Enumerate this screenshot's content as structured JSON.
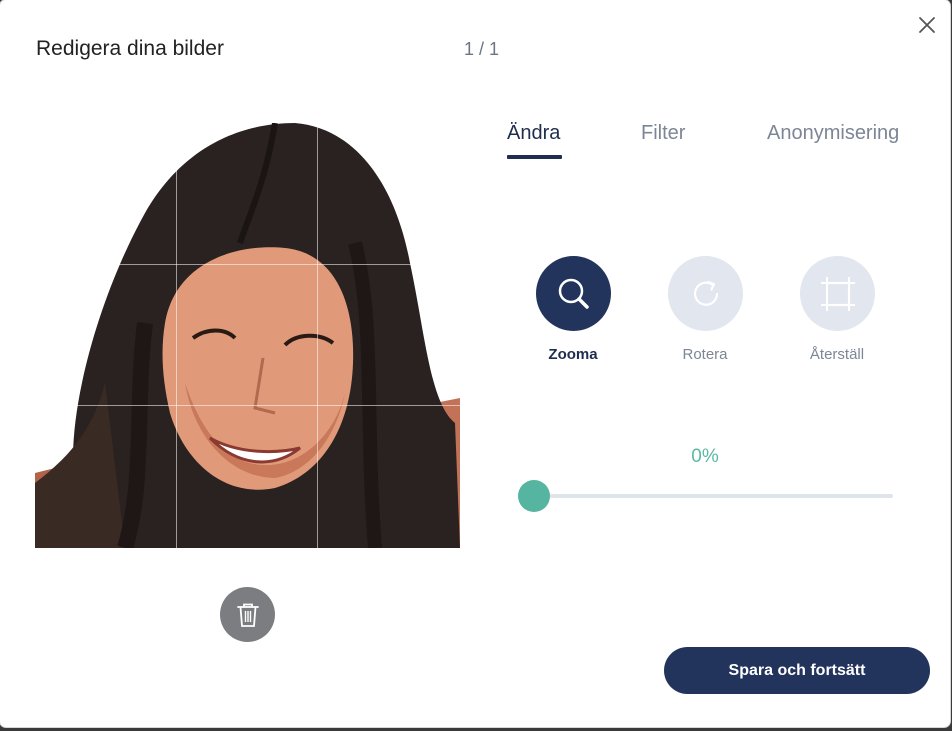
{
  "dialog": {
    "title": "Redigera dina bilder",
    "counter": "1 / 1"
  },
  "tabs": [
    {
      "label": "Ändra",
      "active": true
    },
    {
      "label": "Filter",
      "active": false
    },
    {
      "label": "Anonymisering",
      "active": false
    }
  ],
  "tools": [
    {
      "label": "Zooma",
      "icon": "zoom-icon",
      "active": true
    },
    {
      "label": "Rotera",
      "icon": "rotate-icon",
      "active": false
    },
    {
      "label": "Återställ",
      "icon": "reset-crop-icon",
      "active": false
    }
  ],
  "zoom": {
    "value_label": "0%",
    "value": 0
  },
  "actions": {
    "save_label": "Spara och fortsätt"
  },
  "colors": {
    "primary": "#22345c",
    "accent": "#55b5a0",
    "muted": "#7d8696"
  }
}
